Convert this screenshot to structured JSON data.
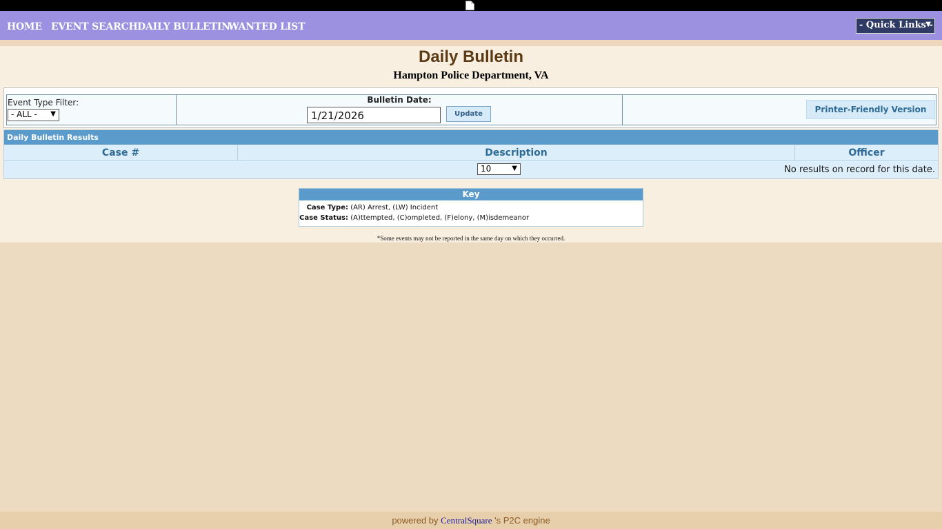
{
  "nav": {
    "items": [
      "HOME",
      "EVENT SEARCH",
      "DAILY BULLETIN",
      "WANTED LIST"
    ],
    "quick_links": "- Quick Links -"
  },
  "page": {
    "title": "Daily Bulletin",
    "subtitle": "Hampton Police Department, VA"
  },
  "filters": {
    "event_type_label": "Event Type Filter:",
    "event_type_selected": "- ALL -",
    "bulletin_date_label": "Bulletin Date:",
    "bulletin_date_value": "1/21/2026",
    "update_label": "Update",
    "printer_label": "Printer-Friendly Version"
  },
  "results": {
    "header": "Daily Bulletin Results",
    "columns": [
      "Case #",
      "Description",
      "Officer"
    ],
    "page_size": "10",
    "empty_message": "No results on record for this date."
  },
  "key": {
    "title": "Key",
    "rows": [
      {
        "term": "Case Type:",
        "definition": "(AR) Arrest, (LW) Incident"
      },
      {
        "term": "Case Status:",
        "definition": "(A)ttempted, (C)ompleted, (F)elony, (M)isdemeanor"
      }
    ]
  },
  "footnote": "*Some events may not be reported in the same day on which they occurred.",
  "footer": {
    "prefix": "powered by",
    "brand": "CentralSquare",
    "suffix": " 's P2C engine"
  },
  "colors": {
    "nav_bg": "#9b91e0",
    "accent_blue": "#5a9bcb",
    "title_brown": "#5b3a14",
    "page_bg": "#eddbc1"
  }
}
